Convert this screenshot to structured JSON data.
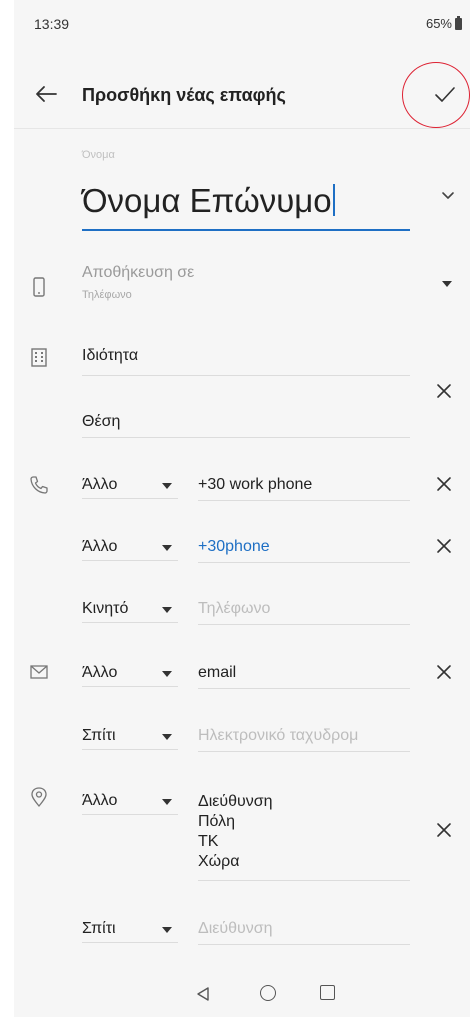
{
  "status": {
    "time": "13:39",
    "battery": "65%"
  },
  "header": {
    "title": "Προσθήκη νέας επαφής"
  },
  "name": {
    "label": "Όνομα",
    "value": "Όνομα Επώνυμο"
  },
  "save_to": {
    "label": "Αποθήκευση σε",
    "sub": "Τηλέφωνο"
  },
  "company": {
    "placeholder": "Ιδιότητα"
  },
  "title_field": {
    "placeholder": "Θέση"
  },
  "phones": [
    {
      "type": "Άλλο",
      "value": "+30 work phone"
    },
    {
      "type": "Άλλο",
      "value": "+30phone"
    },
    {
      "type": "Κινητό",
      "placeholder": "Τηλέφωνο"
    }
  ],
  "emails": [
    {
      "type": "Άλλο",
      "value": "email"
    },
    {
      "type": "Σπίτι",
      "placeholder": "Ηλεκτρονικό ταχυδρομ"
    }
  ],
  "addresses": [
    {
      "type": "Άλλο",
      "lines": [
        "Διεύθυνση",
        "Πόλη",
        "ΤΚ",
        "Χώρα"
      ]
    },
    {
      "type": "Σπίτι",
      "placeholder": "Διεύθυνση"
    }
  ],
  "icons": {
    "back": "arrow-left-icon",
    "save": "check-icon",
    "phone": "phone-icon",
    "email": "mail-icon",
    "location": "location-pin-icon",
    "device": "device-icon",
    "company": "building-icon"
  },
  "colors": {
    "accent": "#1e6fc4",
    "highlight_circle": "#dd2233"
  }
}
